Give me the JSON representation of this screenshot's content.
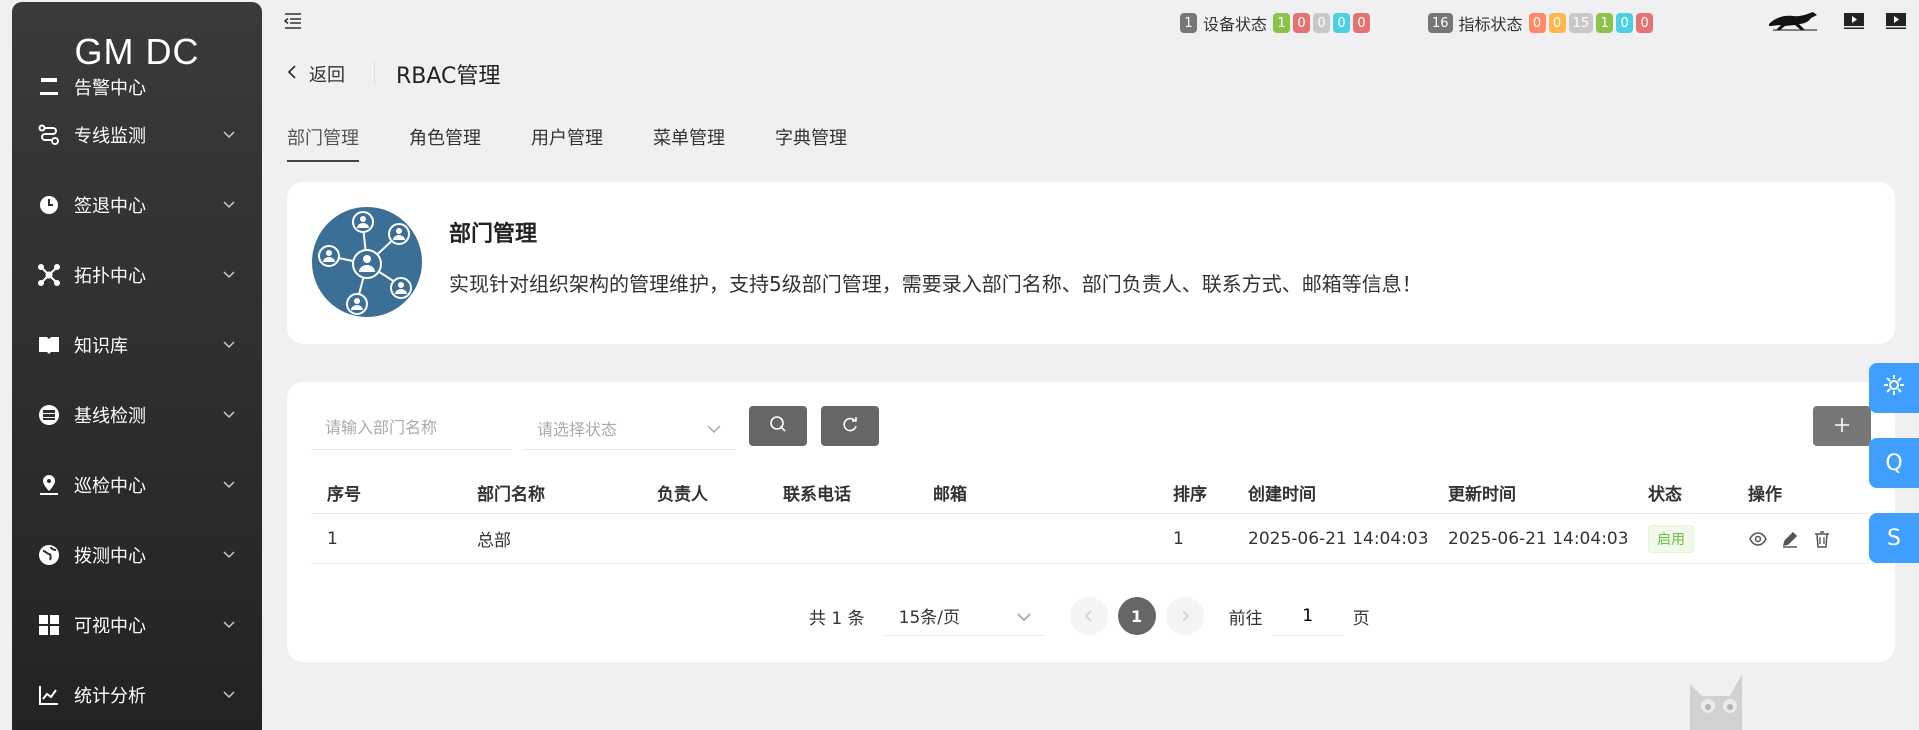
{
  "brand": {
    "title": "GM DC"
  },
  "sidebar": {
    "items": [
      {
        "label": "告警中心",
        "icon": "alarm-icon"
      },
      {
        "label": "专线监测",
        "icon": "route-icon"
      },
      {
        "label": "签退中心",
        "icon": "clock-icon"
      },
      {
        "label": "拓扑中心",
        "icon": "topology-icon"
      },
      {
        "label": "知识库",
        "icon": "book-icon"
      },
      {
        "label": "基线检测",
        "icon": "server-icon"
      },
      {
        "label": "巡检中心",
        "icon": "location-icon"
      },
      {
        "label": "拨测中心",
        "icon": "globe-icon"
      },
      {
        "label": "可视中心",
        "icon": "windows-icon"
      },
      {
        "label": "统计分析",
        "icon": "chart-icon"
      }
    ]
  },
  "topbar": {
    "device": {
      "count": "1",
      "label": "设备状态",
      "badges": [
        "1",
        "0",
        "0",
        "0",
        "0"
      ]
    },
    "metric": {
      "count": "16",
      "label": "指标状态",
      "badges": [
        "0",
        "0",
        "15",
        "1",
        "0",
        "0"
      ]
    }
  },
  "header": {
    "back_label": "返回",
    "title": "RBAC管理"
  },
  "tabs": [
    "部门管理",
    "角色管理",
    "用户管理",
    "菜单管理",
    "字典管理"
  ],
  "info": {
    "title": "部门管理",
    "description": "实现针对组织架构的管理维护，支持5级部门管理，需要录入部门名称、部门负责人、联系方式、邮箱等信息！"
  },
  "filters": {
    "name_placeholder": "请输入部门名称",
    "status_placeholder": "请选择状态"
  },
  "table": {
    "columns": [
      "序号",
      "部门名称",
      "负责人",
      "联系电话",
      "邮箱",
      "排序",
      "创建时间",
      "更新时间",
      "状态",
      "操作"
    ],
    "rows": [
      {
        "index": "1",
        "name": "总部",
        "leader": "",
        "phone": "",
        "email": "",
        "sort": "1",
        "created": "2025-06-21 14:04:03",
        "updated": "2025-06-21 14:04:03",
        "status": "启用"
      }
    ]
  },
  "pagination": {
    "total_label": "共 1 条",
    "page_size": "15条/页",
    "current_page": "1",
    "goto_label": "前往",
    "goto_value": "1",
    "page_unit": "页"
  },
  "float_buttons": [
    "Q",
    "S"
  ],
  "colors": {
    "badge_grey": "#777777",
    "badge_green": "#8bc34a",
    "badge_red": "#e57373",
    "badge_lightgrey": "#c8c8c8",
    "badge_cyan": "#4dd0e1",
    "badge_orange": "#ffb74d",
    "accent_blue": "#409eff"
  }
}
